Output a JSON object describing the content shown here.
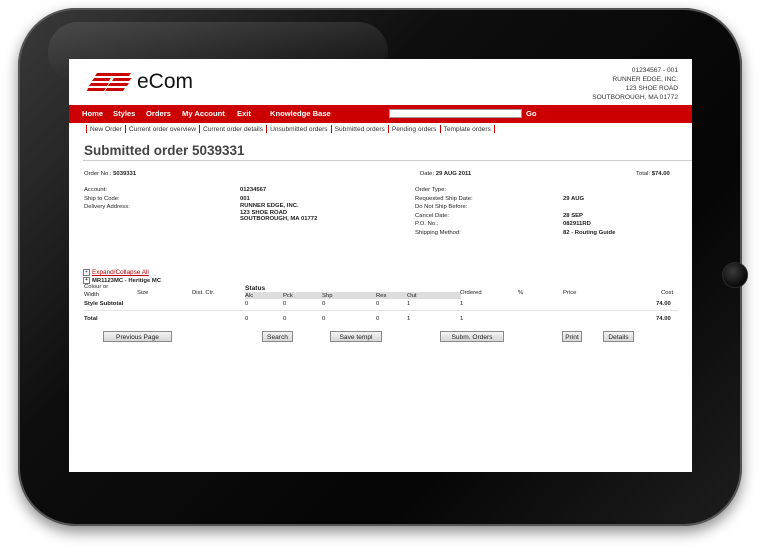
{
  "brand": {
    "name": "eCom",
    "colors": {
      "primary": "#cc0000"
    }
  },
  "account_header": {
    "line1": "01234567 - 001",
    "line2": "RUNNER EDGE, INC.",
    "line3": "123 SHOE ROAD",
    "line4": "SOUTBOROUGH, MA 01772"
  },
  "nav": {
    "items": [
      "Home",
      "Styles",
      "Orders",
      "My Account",
      "Exit",
      "Knowledge Base"
    ],
    "go": "Go",
    "search_placeholder": ""
  },
  "subnav": [
    "New Order",
    "Current order overview",
    "Current order details",
    "Unsubmitted orders",
    "Submitted orders",
    "Pending orders",
    "Template orders"
  ],
  "title": "Submitted order  5039331",
  "summary": {
    "order_no_label": "Order No.:",
    "order_no": "5039331",
    "date_label": "Date:",
    "date": "29 AUG 2011",
    "total_label": "Total:",
    "total": "$74.00"
  },
  "details_left": {
    "account_label": "Account:",
    "account": "01234567",
    "ship_label": "Ship to Code:",
    "ship": "001",
    "delivery_label": "Delivery Address:",
    "delivery": [
      "RUNNER EDGE, INC.",
      "123 SHOE ROAD",
      "SOUTBOROUGH, MA 01772"
    ]
  },
  "details_right": {
    "order_type_label": "Order Type:",
    "order_type": "",
    "req_ship_label": "Requested Ship Date:",
    "req_ship": "29 AUG",
    "no_ship_label": "Do Not Ship Before:",
    "no_ship": "",
    "cancel_label": "Cancel Date:",
    "cancel": "28 SEP",
    "po_label": "P.O. No.:",
    "po": "082911RD",
    "method_label": "Shipping Method:",
    "method": "82 - Routing Guide"
  },
  "expand_all": "Expand/Collapse All",
  "style_row": "MR1123MC - Heritige MC",
  "table": {
    "headers": {
      "colour": "Colour or",
      "width": "Width",
      "size": "Size",
      "dist": "Dist. Ctr.",
      "status": "Status",
      "ordered": "Ordered",
      "pct": "%",
      "price": "Price",
      "cost": "Cost"
    },
    "status_cols": [
      "Alc",
      "Pck",
      "Shp",
      "Res",
      "Out"
    ],
    "subtotal": {
      "label": "Style Subtotal",
      "alc": "0",
      "pck": "0",
      "shp": "0",
      "res": "0",
      "out": "1",
      "ordered": "1",
      "cost": "74.00"
    },
    "total": {
      "label": "Total",
      "alc": "0",
      "pck": "0",
      "shp": "0",
      "res": "0",
      "out": "1",
      "ordered": "1",
      "cost": "74.00"
    }
  },
  "buttons": {
    "previous": "Previous Page",
    "search": "Search",
    "save": "Save templ",
    "submit": "Subm. Orders",
    "print": "Print",
    "details": "Details"
  }
}
